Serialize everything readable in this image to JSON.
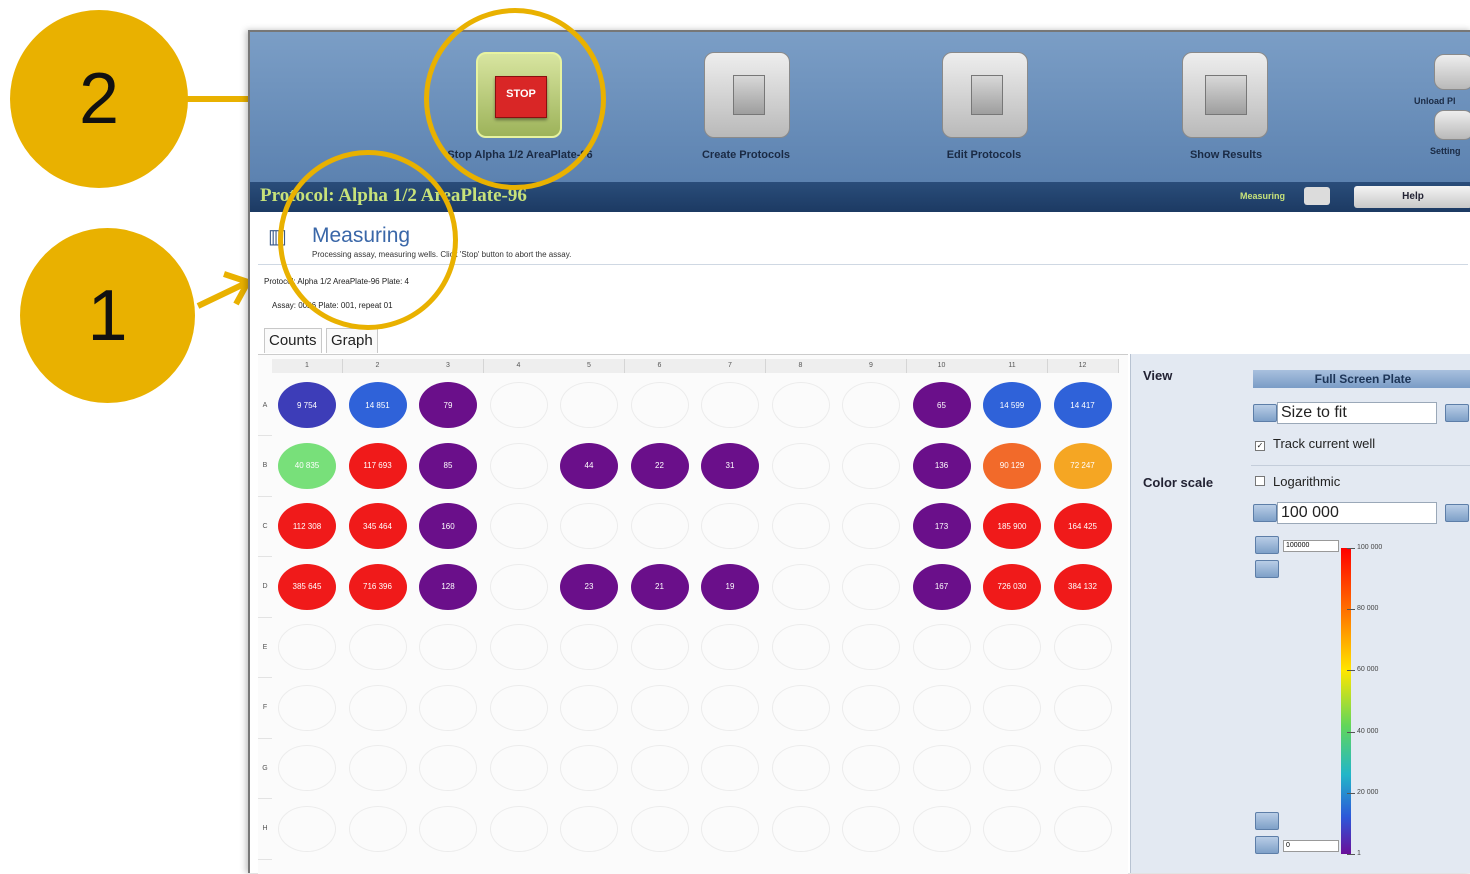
{
  "callouts": {
    "one": "1",
    "two": "2"
  },
  "toolbar": {
    "stop_icon_text": "STOP",
    "stop_label": "Stop Alpha 1/2 AreaPlate-96",
    "create_label": "Create Protocols",
    "edit_label": "Edit Protocols",
    "results_label": "Show Results",
    "unload_label": "Unload Pl",
    "settings_label": "Setting"
  },
  "protocol_bar": {
    "title": "Protocol: Alpha 1/2 AreaPlate-96",
    "status": "Measuring",
    "help": "Help"
  },
  "measure": {
    "heading": "Measuring",
    "description": "Processing assay, measuring wells. Click 'Stop' button to abort the assay.",
    "protocol_line": "Protocol: Alpha 1/2 AreaPlate-96    Plate: 4",
    "assay_line": "Assay: 0026   Plate: 001,   repeat 01"
  },
  "tabs": {
    "counts": "Counts",
    "graph": "Graph"
  },
  "plate": {
    "columns": [
      "1",
      "2",
      "3",
      "4",
      "5",
      "6",
      "7",
      "8",
      "9",
      "10",
      "11",
      "12"
    ],
    "rows": [
      "A",
      "B",
      "C",
      "D",
      "E",
      "F",
      "G",
      "H"
    ],
    "wells": [
      {
        "row": 0,
        "col": 0,
        "value": "9 754",
        "color": "#3d3db8"
      },
      {
        "row": 0,
        "col": 1,
        "value": "14 851",
        "color": "#2f62d9"
      },
      {
        "row": 0,
        "col": 2,
        "value": "79",
        "color": "#6a0f8a"
      },
      {
        "row": 0,
        "col": 9,
        "value": "65",
        "color": "#6a0f8a"
      },
      {
        "row": 0,
        "col": 10,
        "value": "14 599",
        "color": "#2f62d9"
      },
      {
        "row": 0,
        "col": 11,
        "value": "14 417",
        "color": "#2f62d9"
      },
      {
        "row": 1,
        "col": 0,
        "value": "40 835",
        "color": "#78e07a"
      },
      {
        "row": 1,
        "col": 1,
        "value": "117 693",
        "color": "#f01a1a"
      },
      {
        "row": 1,
        "col": 2,
        "value": "85",
        "color": "#6a0f8a"
      },
      {
        "row": 1,
        "col": 4,
        "value": "44",
        "color": "#6a0f8a"
      },
      {
        "row": 1,
        "col": 5,
        "value": "22",
        "color": "#6a0f8a"
      },
      {
        "row": 1,
        "col": 6,
        "value": "31",
        "color": "#6a0f8a"
      },
      {
        "row": 1,
        "col": 9,
        "value": "136",
        "color": "#6a0f8a"
      },
      {
        "row": 1,
        "col": 10,
        "value": "90 129",
        "color": "#f26a2a"
      },
      {
        "row": 1,
        "col": 11,
        "value": "72 247",
        "color": "#f5a623"
      },
      {
        "row": 2,
        "col": 0,
        "value": "112 308",
        "color": "#f01a1a"
      },
      {
        "row": 2,
        "col": 1,
        "value": "345 464",
        "color": "#f01a1a"
      },
      {
        "row": 2,
        "col": 2,
        "value": "160",
        "color": "#6a0f8a"
      },
      {
        "row": 2,
        "col": 9,
        "value": "173",
        "color": "#6a0f8a"
      },
      {
        "row": 2,
        "col": 10,
        "value": "185 900",
        "color": "#f01a1a"
      },
      {
        "row": 2,
        "col": 11,
        "value": "164 425",
        "color": "#f01a1a"
      },
      {
        "row": 3,
        "col": 0,
        "value": "385 645",
        "color": "#f01a1a"
      },
      {
        "row": 3,
        "col": 1,
        "value": "716 396",
        "color": "#f01a1a"
      },
      {
        "row": 3,
        "col": 2,
        "value": "128",
        "color": "#6a0f8a"
      },
      {
        "row": 3,
        "col": 4,
        "value": "23",
        "color": "#6a0f8a"
      },
      {
        "row": 3,
        "col": 5,
        "value": "21",
        "color": "#6a0f8a"
      },
      {
        "row": 3,
        "col": 6,
        "value": "19",
        "color": "#6a0f8a"
      },
      {
        "row": 3,
        "col": 9,
        "value": "167",
        "color": "#6a0f8a"
      },
      {
        "row": 3,
        "col": 10,
        "value": "726 030",
        "color": "#f01a1a"
      },
      {
        "row": 3,
        "col": 11,
        "value": "384 132",
        "color": "#f01a1a"
      }
    ]
  },
  "side": {
    "view_label": "View",
    "fullscreen": "Full Screen Plate",
    "size_value": "Size to fit",
    "track_label": "Track current well",
    "colorscale_label": "Color scale",
    "log_label": "Logarithmic",
    "scale_value": "100 000",
    "scale_max_input": "100000",
    "scale_min_input": "0",
    "ticks": [
      "100 000",
      "80 000",
      "60 000",
      "40 000",
      "20 000",
      "1"
    ]
  }
}
